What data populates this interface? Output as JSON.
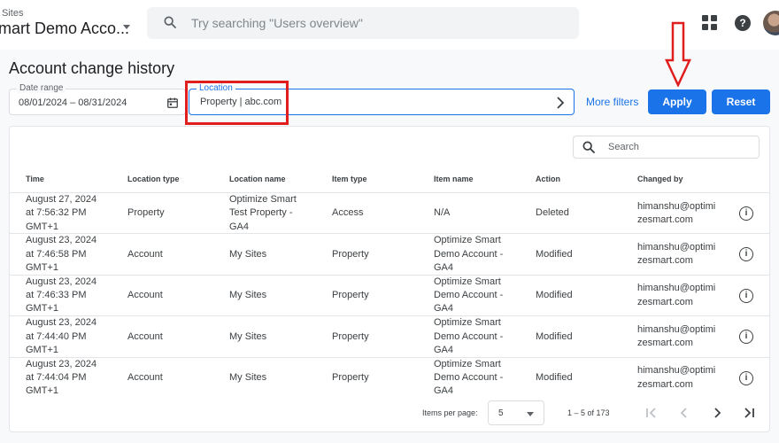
{
  "header": {
    "breadcrumb": "Sites",
    "account_name": "mart Demo Acco...",
    "search_placeholder": "Try searching \"Users overview\""
  },
  "page": {
    "title": "Account change history"
  },
  "filters": {
    "date_range_label": "Date range",
    "date_range_value": "08/01/2024 – 08/31/2024",
    "location_label": "Location",
    "location_value": "Property | abc.com",
    "more_filters": "More filters",
    "apply": "Apply",
    "reset": "Reset"
  },
  "table": {
    "search_placeholder": "Search",
    "columns": [
      "Time",
      "Location type",
      "Location name",
      "Item type",
      "Item name",
      "Action",
      "Changed by"
    ],
    "rows": [
      {
        "time": "August 27, 2024\nat 7:56:32 PM\nGMT+1",
        "location_type": "Property",
        "location_name": "Optimize Smart\nTest Property -\nGA4",
        "item_type": "Access",
        "item_name": "N/A",
        "action": "Deleted",
        "changed_by": "himanshu@optimi\nzesmart.com"
      },
      {
        "time": "August 23, 2024\nat 7:46:58 PM\nGMT+1",
        "location_type": "Account",
        "location_name": "My Sites",
        "item_type": "Property",
        "item_name": "Optimize Smart\nDemo Account -\nGA4",
        "action": "Modified",
        "changed_by": "himanshu@optimi\nzesmart.com"
      },
      {
        "time": "August 23, 2024\nat 7:46:33 PM\nGMT+1",
        "location_type": "Account",
        "location_name": "My Sites",
        "item_type": "Property",
        "item_name": "Optimize Smart\nDemo Account -\nGA4",
        "action": "Modified",
        "changed_by": "himanshu@optimi\nzesmart.com"
      },
      {
        "time": "August 23, 2024\nat 7:44:40 PM\nGMT+1",
        "location_type": "Account",
        "location_name": "My Sites",
        "item_type": "Property",
        "item_name": "Optimize Smart\nDemo Account -\nGA4",
        "action": "Modified",
        "changed_by": "himanshu@optimi\nzesmart.com"
      },
      {
        "time": "August 23, 2024\nat 7:44:04 PM\nGMT+1",
        "location_type": "Account",
        "location_name": "My Sites",
        "item_type": "Property",
        "item_name": "Optimize Smart\nDemo Account -\nGA4",
        "action": "Modified",
        "changed_by": "himanshu@optimi\nzesmart.com"
      }
    ]
  },
  "pagination": {
    "items_per_page_label": "Items per page:",
    "items_per_page_value": "5",
    "range": "1 – 5 of 173"
  },
  "icons": {
    "info": "info-icon",
    "search": "search-icon",
    "calendar": "calendar-icon",
    "apps": "apps-grid-icon",
    "help": "help-icon"
  },
  "colors": {
    "accent": "#1a73e8",
    "highlight_box": "#e01e1e"
  }
}
